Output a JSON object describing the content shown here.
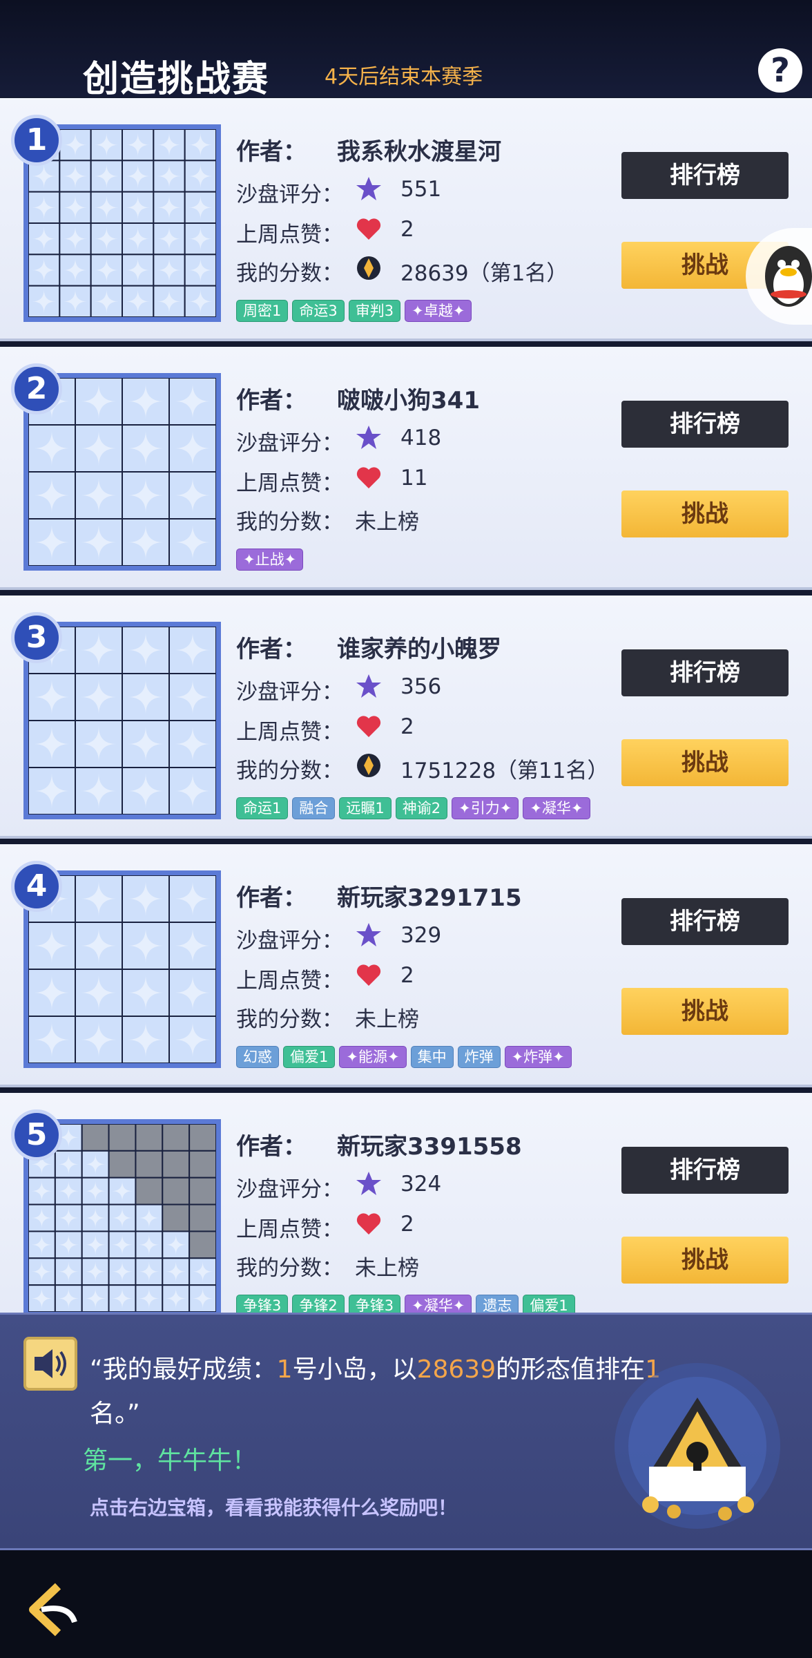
{
  "header": {
    "title": "创造挑战赛",
    "subtitle": "4天后结束本赛季",
    "help_label": "?"
  },
  "labels": {
    "author": "作者：",
    "sandbox_rating": "沙盘评分：",
    "last_week_likes": "上周点赞：",
    "my_score": "我的分数：",
    "ranking_button": "排行榜",
    "challenge_button": "挑战"
  },
  "cards": [
    {
      "rank": "1",
      "author": "我系秋水渡星河",
      "rating": "551",
      "likes": "2",
      "score": "28639（第1名）",
      "has_score": true,
      "tags": [
        {
          "text": "周密1",
          "color": "green"
        },
        {
          "text": "命运3",
          "color": "green"
        },
        {
          "text": "审判3",
          "color": "green"
        },
        {
          "text": "✦卓越✦",
          "color": "purple"
        }
      ]
    },
    {
      "rank": "2",
      "author": "啵啵小狗341",
      "rating": "418",
      "likes": "11",
      "score": "未上榜",
      "has_score": false,
      "tags": [
        {
          "text": "✦止战✦",
          "color": "purple"
        }
      ]
    },
    {
      "rank": "3",
      "author": "谁家养的小魄罗",
      "rating": "356",
      "likes": "2",
      "score": "1751228（第11名）",
      "has_score": true,
      "tags": [
        {
          "text": "命运1",
          "color": "green"
        },
        {
          "text": "融合",
          "color": "blue"
        },
        {
          "text": "远瞩1",
          "color": "green"
        },
        {
          "text": "神谕2",
          "color": "green"
        },
        {
          "text": "✦引力✦",
          "color": "purple"
        },
        {
          "text": "✦凝华✦",
          "color": "purple"
        }
      ]
    },
    {
      "rank": "4",
      "author": "新玩家3291715",
      "rating": "329",
      "likes": "2",
      "score": "未上榜",
      "has_score": false,
      "tags": [
        {
          "text": "幻惑",
          "color": "blue"
        },
        {
          "text": "偏爱1",
          "color": "green"
        },
        {
          "text": "✦能源✦",
          "color": "purple"
        },
        {
          "text": "集中",
          "color": "blue"
        },
        {
          "text": "炸弹",
          "color": "blue"
        },
        {
          "text": "✦炸弹✦",
          "color": "purple"
        }
      ]
    },
    {
      "rank": "5",
      "author": "新玩家3391558",
      "rating": "324",
      "likes": "2",
      "score": "未上榜",
      "has_score": false,
      "tags": [
        {
          "text": "争锋3",
          "color": "green"
        },
        {
          "text": "争锋2",
          "color": "green"
        },
        {
          "text": "争锋3",
          "color": "green"
        },
        {
          "text": "✦凝华✦",
          "color": "purple"
        },
        {
          "text": "遗志",
          "color": "blue"
        },
        {
          "text": "偏爱1",
          "color": "green"
        }
      ]
    }
  ],
  "message": {
    "quote_open": "“我的最好成绩：",
    "island_num": "1",
    "quote_mid": "号小岛，以",
    "score_value": "28639",
    "quote_mid2": "的形态值排在",
    "rank_value": "1",
    "quote_close": "名。”",
    "praise": "第一，牛牛牛！",
    "hint": "点击右边宝箱，看看我能获得什么奖励吧！"
  },
  "icons": {
    "speaker": "speaker-icon",
    "star": "star-icon",
    "heart": "heart-icon",
    "coin": "coin-icon",
    "back": "back-arrow-icon",
    "chest": "treasure-chest-icon",
    "penguin": "qq-penguin-icon"
  },
  "colors": {
    "accent_orange": "#f5a64a",
    "praise_green": "#5fe3a0",
    "board_border": "#5b7ad6"
  }
}
